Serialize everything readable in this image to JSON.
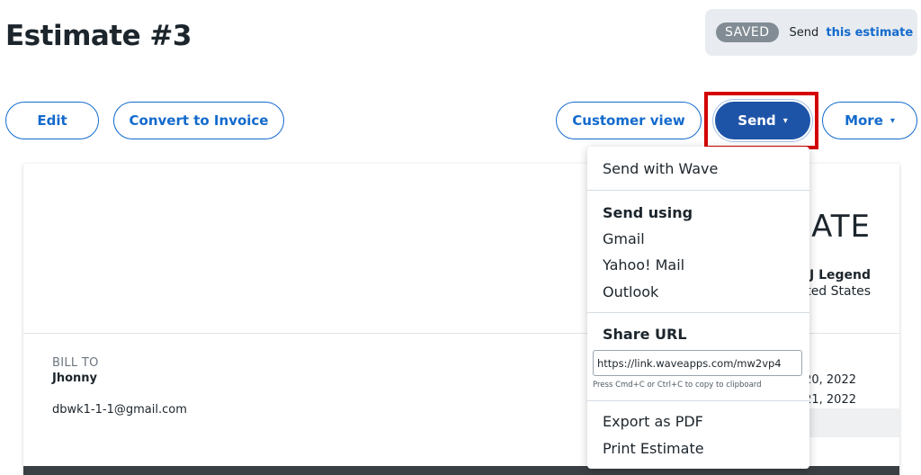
{
  "page": {
    "title": "Estimate #3"
  },
  "status": {
    "badge": "SAVED",
    "prefix": "Send",
    "link": "this estimate"
  },
  "toolbar": {
    "edit": "Edit",
    "convert": "Convert to Invoice",
    "customer_view": "Customer view",
    "send": "Send",
    "more": "More",
    "caret": "▾"
  },
  "document": {
    "heading_partial": "ATE",
    "company_partial": "DJ Legend",
    "country_partial": "ted States",
    "bill_to_label": "BILL TO",
    "customer_name": "Jhonny",
    "customer_email": "dbwk1-1-1@gmail.com",
    "date1_partial": "20, 2022",
    "date2_partial": "21, 2022"
  },
  "send_menu": {
    "send_with_wave": "Send with Wave",
    "send_using_heading": "Send using",
    "gmail": "Gmail",
    "yahoo": "Yahoo! Mail",
    "outlook": "Outlook",
    "share_url_heading": "Share URL",
    "share_url_value": "https://link.waveapps.com/mw2vp4",
    "share_hint": "Press Cmd+C or Ctrl+C to copy to clipboard",
    "export_pdf": "Export as PDF",
    "print": "Print Estimate"
  },
  "colors": {
    "accent": "#136acd",
    "send_button": "#1e54a8",
    "highlight": "#d40000"
  }
}
